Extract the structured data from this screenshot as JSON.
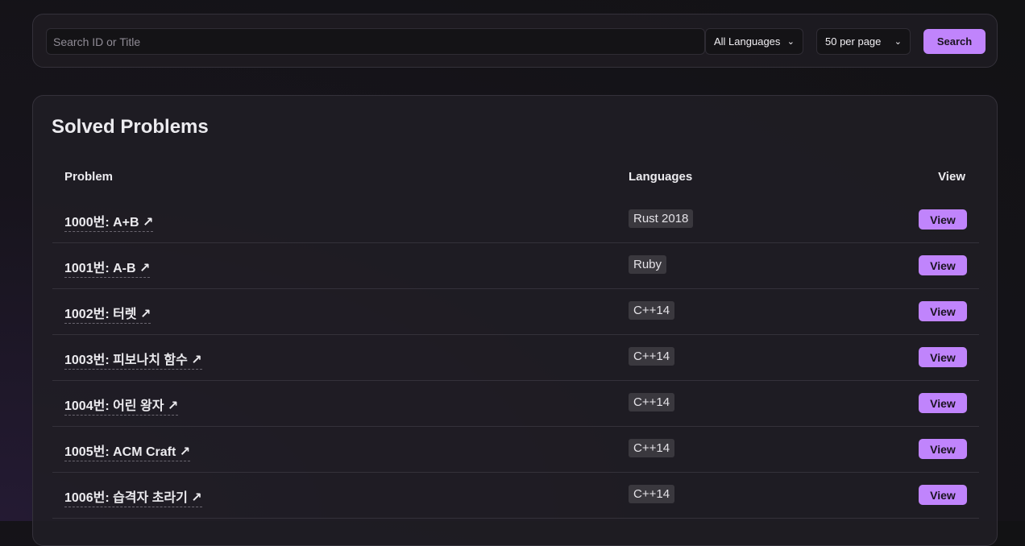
{
  "filters": {
    "search_placeholder": "Search ID or Title",
    "search_value": "",
    "language_selected": "All Languages",
    "per_page_selected": "50 per page",
    "search_button_label": "Search"
  },
  "panel": {
    "title": "Solved Problems",
    "headers": {
      "problem": "Problem",
      "languages": "Languages",
      "view": "View"
    },
    "rows": [
      {
        "problem": "1000번: A+B ↗",
        "language": "Rust 2018",
        "view_label": "View"
      },
      {
        "problem": "1001번: A-B ↗",
        "language": "Ruby",
        "view_label": "View"
      },
      {
        "problem": "1002번: 터렛 ↗",
        "language": "C++14",
        "view_label": "View"
      },
      {
        "problem": "1003번: 피보나치 함수 ↗",
        "language": "C++14",
        "view_label": "View"
      },
      {
        "problem": "1004번: 어린 왕자 ↗",
        "language": "C++14",
        "view_label": "View"
      },
      {
        "problem": "1005번: ACM Craft ↗",
        "language": "C++14",
        "view_label": "View"
      },
      {
        "problem": "1006번: 습격자 초라기 ↗",
        "language": "C++14",
        "view_label": "View"
      },
      {
        "problem": "",
        "language": "",
        "view_label": ""
      }
    ]
  },
  "icons": {
    "select_chevron": "chevron-down-icon",
    "external_link": "arrow-up-right-icon"
  },
  "colors": {
    "accent": "#c084fc",
    "background": "#17141c",
    "panel": "#201e24",
    "badge": "#3a383e"
  }
}
